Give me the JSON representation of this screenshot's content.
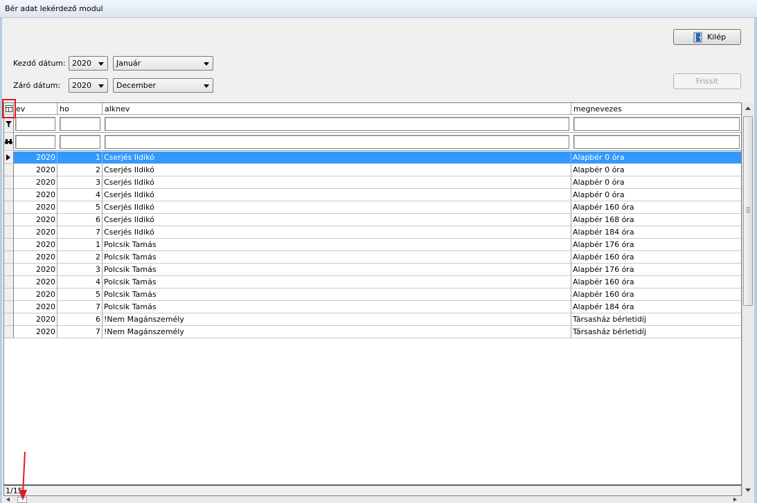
{
  "window": {
    "title": "Bér adat lekérdező modul"
  },
  "buttons": {
    "exit_label": "Kilép",
    "refresh_label": "Frissít"
  },
  "filters": {
    "start_label": "Kezdő dátum:",
    "end_label": "Záró dátum:",
    "start_year": "2020",
    "start_month": "Január",
    "end_year": "2020",
    "end_month": "December"
  },
  "grid": {
    "columns": [
      "ev",
      "ho",
      "alknev",
      "megnevezes"
    ],
    "rows": [
      [
        "2020",
        "1",
        "Cserjés Ildikó",
        "Alapbér 0 óra"
      ],
      [
        "2020",
        "2",
        "Cserjés Ildikó",
        "Alapbér 0 óra"
      ],
      [
        "2020",
        "3",
        "Cserjés Ildikó",
        "Alapbér 0 óra"
      ],
      [
        "2020",
        "4",
        "Cserjés Ildikó",
        "Alapbér 0 óra"
      ],
      [
        "2020",
        "5",
        "Cserjés Ildikó",
        "Alapbér 160 óra"
      ],
      [
        "2020",
        "6",
        "Cserjés Ildikó",
        "Alapbér 168 óra"
      ],
      [
        "2020",
        "7",
        "Cserjés Ildikó",
        "Alapbér 184 óra"
      ],
      [
        "2020",
        "1",
        " Polcsik Tamás",
        "Alapbér 176 óra"
      ],
      [
        "2020",
        "2",
        " Polcsik Tamás",
        "Alapbér 160 óra"
      ],
      [
        "2020",
        "3",
        " Polcsik Tamás",
        "Alapbér 176 óra"
      ],
      [
        "2020",
        "4",
        " Polcsik Tamás",
        "Alapbér 160 óra"
      ],
      [
        "2020",
        "5",
        " Polcsik Tamás",
        "Alapbér 160 óra"
      ],
      [
        "2020",
        "7",
        " Polcsik Tamás",
        "Alapbér 184 óra"
      ],
      [
        "2020",
        "6",
        "!Nem Magánszemély",
        "Társasház bérletidíj"
      ],
      [
        "2020",
        "7",
        "!Nem Magánszemély",
        "Társasház bérletidíj"
      ]
    ]
  },
  "status": {
    "record_position": "1/15"
  },
  "annotations": {
    "highlight_color": "#e0191f"
  }
}
